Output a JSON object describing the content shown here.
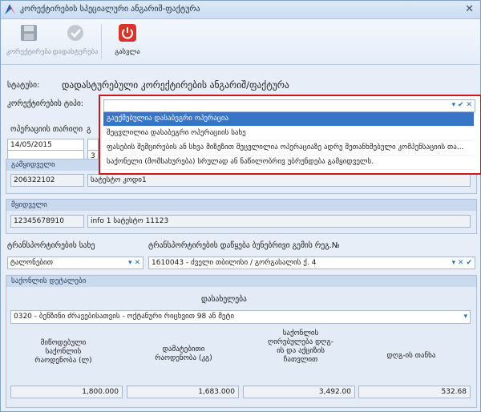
{
  "window": {
    "title": "კორექტირების სპეციალური ანგარიშ-ფაქტურა",
    "close_glyph": "✕"
  },
  "toolbar": {
    "correct_label": "კორექტირება",
    "confirm_label": "დადასტურება",
    "cancel_label": "გასვლა"
  },
  "status": {
    "label": "სტატუსი:",
    "value": "დადასტურებული კორექტირების ანგარიშ/ფაქტურა"
  },
  "correction_type": {
    "label": "კორექტირების ტიპი:",
    "options": [
      "გაუქმებულია დასაბეგრი ოპერაცია",
      "შეცვლილია დასაბეგრი ოპერაციის სახე",
      "ფასების შემცირების ან სხვა მიზეზით შეცვლილია ოპერაციაზე ადრე შეთანხმებული კომპენსაციის თა...",
      "საქონელი (მომსახურება) სრულად ან ნაწილობრივ უბრუნდება გამყიდველს."
    ],
    "selected_index": 0
  },
  "operation_date": {
    "label": "ოპერაციის თარიღი",
    "value": "14/05/2015",
    "label2_fragment": "გ"
  },
  "row2_values": {
    "left": "",
    "right": "3"
  },
  "seller": {
    "heading": "გამყიდველი",
    "tin": "206322102",
    "name": "სატესტო კოდი1"
  },
  "buyer": {
    "heading": "მყიდველი",
    "tin": "12345678910",
    "name": "info  1 სატესტო 11123"
  },
  "transport": {
    "type_label": "ტრანსპორტირების სახე",
    "type_value": "ტალონებით",
    "place_label": "ტრანსპორტირების დაწყება ბუნებრივი გემის რეგ.№",
    "place_value": "1610043 - ძველი თბილისი / გორგასალის ქ. 4"
  },
  "goods": {
    "heading": "საქონლის დეტალები",
    "name_label": "დასახელება",
    "name_value": "0320 - ბენზინი ძრავებისათვის - ოქტანური რიცხვით 98 ან მეტი",
    "col1_label": "მიწოდებული საქონლის რაოდენობა (ლ)",
    "col2_label": "დამატებითი რაოდენობა (კგ)",
    "col3_label": "საქონლის ღირებულება დღგ-ის და აქციზის ჩათვლით",
    "col4_label": "დღგ-ის თანხა",
    "col1_value": "1,800.000",
    "col2_value": "1,683.000",
    "col3_value": "3,492.00",
    "col4_value": "532.68"
  },
  "icons": {
    "dropdown": "▾",
    "clear": "✕",
    "ok": "✔"
  }
}
